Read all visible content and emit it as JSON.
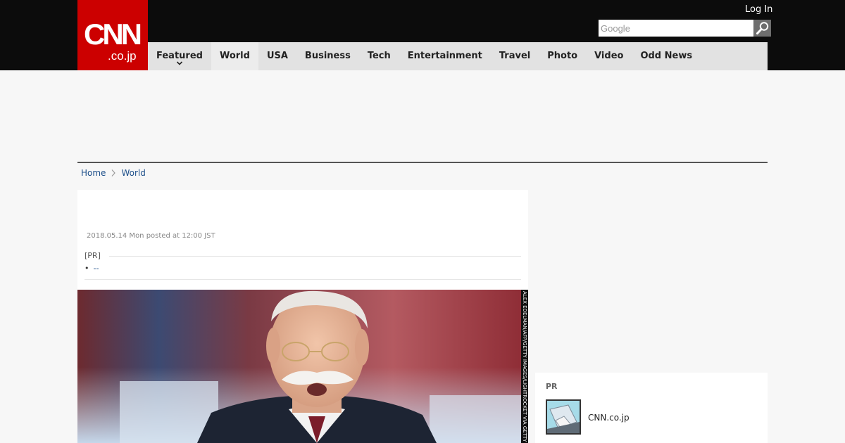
{
  "header": {
    "logo_main": "CNN",
    "logo_sub": ".co.jp",
    "login_label": "Log In",
    "search_placeholder": "Google",
    "search_icon": "magnifier-icon"
  },
  "nav": {
    "items": [
      {
        "label": "Featured",
        "has_dropdown": true
      },
      {
        "label": "World",
        "active": true
      },
      {
        "label": "USA"
      },
      {
        "label": "Business"
      },
      {
        "label": "Tech"
      },
      {
        "label": "Entertainment"
      },
      {
        "label": "Travel"
      },
      {
        "label": "Photo"
      },
      {
        "label": "Video"
      },
      {
        "label": "Odd News"
      }
    ]
  },
  "breadcrumb": {
    "home": "Home",
    "current": "World"
  },
  "article": {
    "posted": "2018.05.14 Mon posted at 12:00 JST",
    "pr_label": "[PR]",
    "pr_link": "--",
    "photo_credit": "ALEX EDELMAN/AFP/GETTY IMAGES/LIGHTROCKET VIA GETTY IMAGES"
  },
  "sidebar_pr": {
    "label": "PR",
    "name": "CNN.co.jp"
  },
  "colors": {
    "brand_red": "#cc0000",
    "topbar": "#0c0c0c",
    "nav_bg": "#e2e2e2",
    "link": "#1d4f8a"
  }
}
